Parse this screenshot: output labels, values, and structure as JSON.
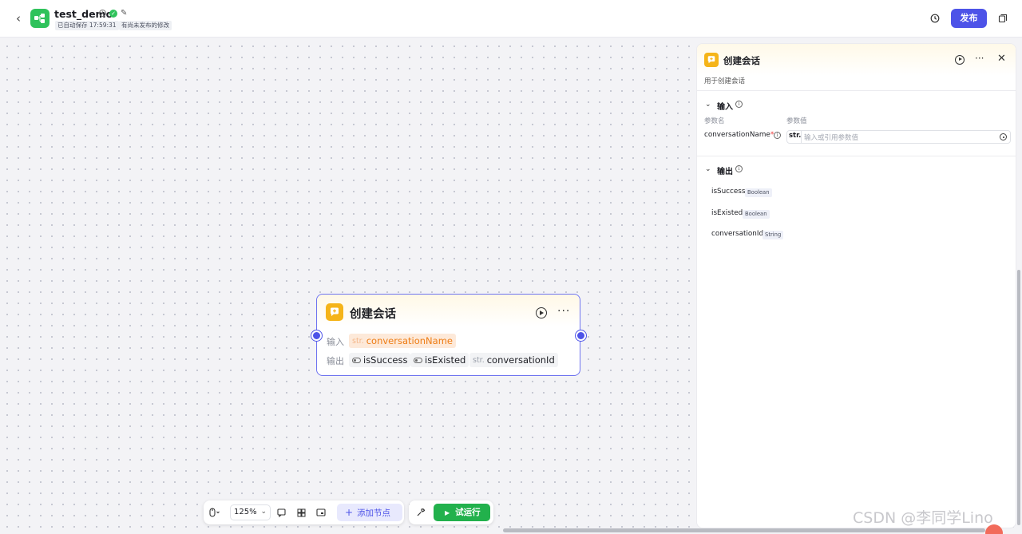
{
  "header": {
    "app_title": "test_demo",
    "autosave_tag": "已自动保存 17:59:31",
    "unpublished_tag": "有尚未发布的修改",
    "publish_label": "发布"
  },
  "node": {
    "title": "创建会话",
    "input_label": "输入",
    "output_label": "输出",
    "input_param": {
      "type": "str.",
      "name": "conversationName"
    },
    "outputs": [
      {
        "type": "toggle",
        "name": "isSuccess"
      },
      {
        "type": "toggle",
        "name": "isExisted"
      },
      {
        "type": "str.",
        "name": "conversationId"
      }
    ]
  },
  "toolbar": {
    "zoom": "125%",
    "add_node_label": "添加节点",
    "run_label": "试运行"
  },
  "panel": {
    "title": "创建会话",
    "description": "用于创建会话",
    "input_section": "输入",
    "param_name_header": "参数名",
    "param_value_header": "参数值",
    "input_param_name": "conversationName",
    "input_param_required": "*",
    "input_param_type": "str.",
    "input_placeholder": "输入或引用参数值",
    "output_section": "输出",
    "outputs": [
      {
        "name": "isSuccess",
        "type": "Boolean"
      },
      {
        "name": "isExisted",
        "type": "Boolean"
      },
      {
        "name": "conversationId",
        "type": "String"
      }
    ]
  },
  "watermark": "CSDN @李同学Lino",
  "colors": {
    "accent": "#4d53e8",
    "run_green": "#22b14c",
    "node_icon": "#f5b419",
    "app_icon": "#2fc25b"
  }
}
